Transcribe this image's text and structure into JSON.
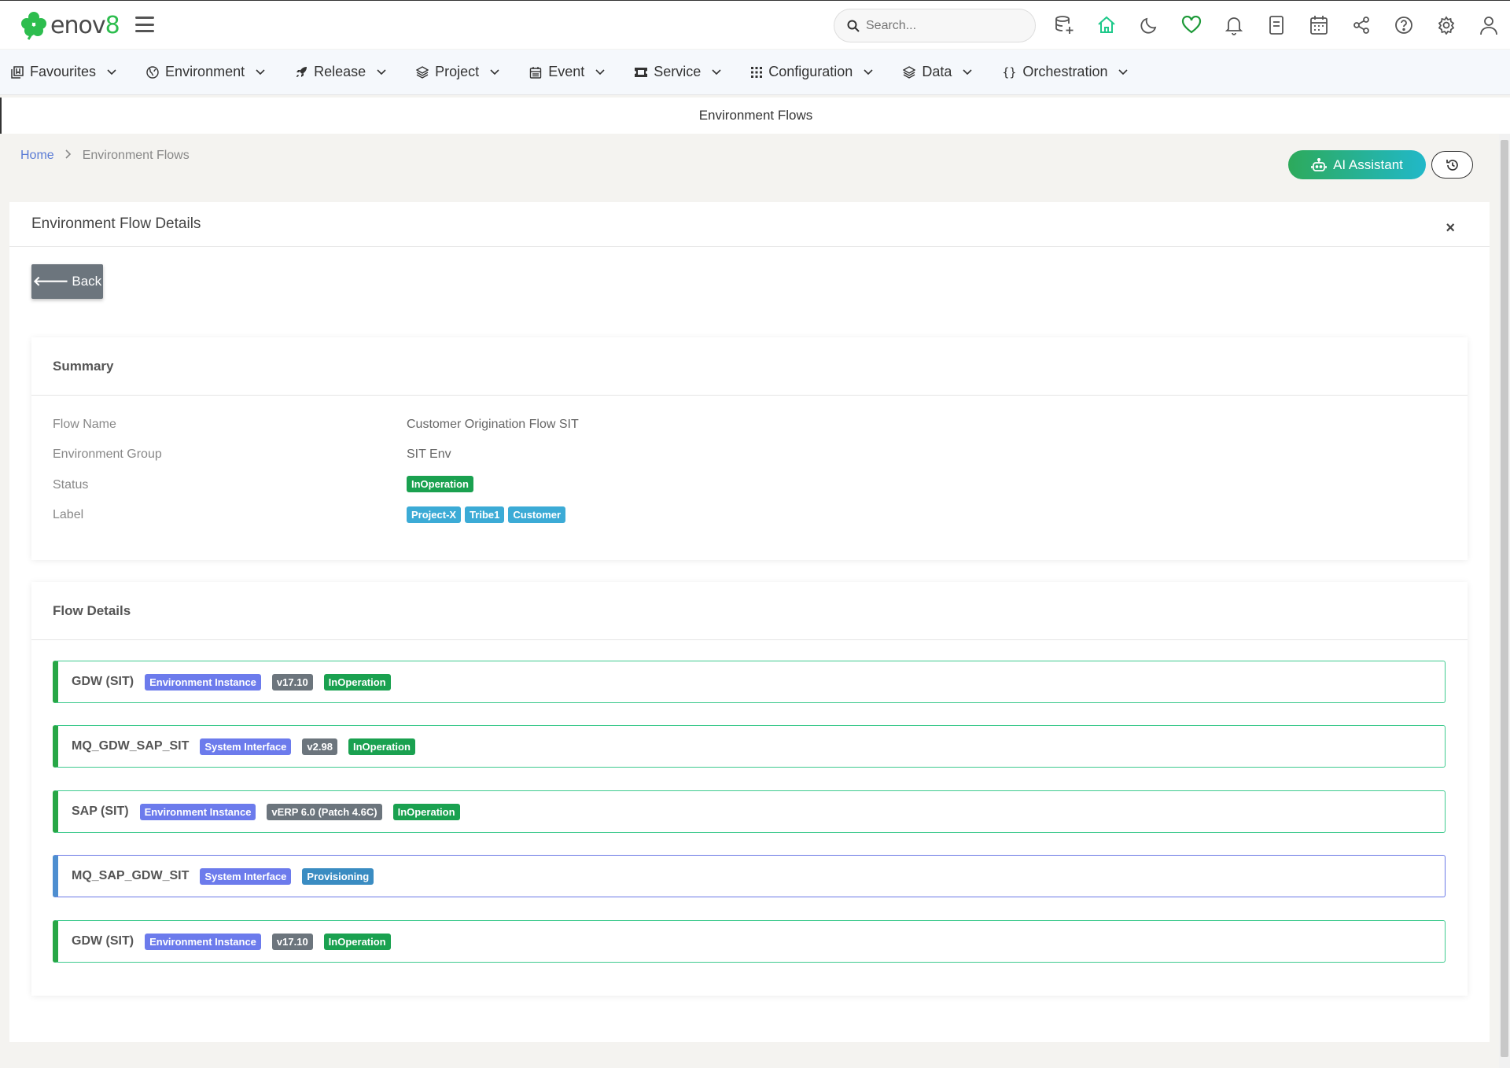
{
  "app": {
    "logo_text": "enov",
    "logo_eight": "8"
  },
  "search": {
    "placeholder": "Search..."
  },
  "top_icons": [
    "database-add-icon",
    "home-icon",
    "moon-icon",
    "heart-icon",
    "bell-icon",
    "document-icon",
    "calendar-icon",
    "share-icon",
    "help-icon",
    "gear-icon",
    "user-icon"
  ],
  "nav": {
    "items": [
      {
        "label": "Favourites",
        "icon": "favourites-icon"
      },
      {
        "label": "Environment",
        "icon": "globe-icon"
      },
      {
        "label": "Release",
        "icon": "rocket-icon"
      },
      {
        "label": "Project",
        "icon": "layers-icon"
      },
      {
        "label": "Event",
        "icon": "calendar-icon"
      },
      {
        "label": "Service",
        "icon": "ticket-icon"
      },
      {
        "label": "Configuration",
        "icon": "grid-icon"
      },
      {
        "label": "Data",
        "icon": "layers-icon"
      },
      {
        "label": "Orchestration",
        "icon": "braces-icon"
      }
    ]
  },
  "page_title": "Environment Flows",
  "breadcrumb": {
    "home": "Home",
    "current": "Environment Flows"
  },
  "actions": {
    "ai_assistant": "AI Assistant"
  },
  "card": {
    "title": "Environment Flow Details",
    "close": "×",
    "back": "Back"
  },
  "summary": {
    "title": "Summary",
    "rows": [
      {
        "label": "Flow Name",
        "value": "Customer Origination Flow SIT"
      },
      {
        "label": "Environment Group",
        "value": "SIT Env"
      },
      {
        "label": "Status",
        "value": "InOperation"
      },
      {
        "label": "Label",
        "values": [
          "Project-X",
          "Tribe1",
          "Customer"
        ]
      }
    ]
  },
  "flow_details": {
    "title": "Flow Details",
    "items": [
      {
        "name": "GDW (SIT)",
        "type": "Environment Instance",
        "version": "v17.10",
        "status": "InOperation"
      },
      {
        "name": "MQ_GDW_SAP_SIT",
        "type": "System Interface",
        "version": "v2.98",
        "status": "InOperation"
      },
      {
        "name": "SAP (SIT)",
        "type": "Environment Instance",
        "version": "vERP 6.0 (Patch 4.6C)",
        "status": "InOperation"
      },
      {
        "name": "MQ_SAP_GDW_SIT",
        "type": "System Interface",
        "version": null,
        "status": "Provisioning"
      },
      {
        "name": "GDW (SIT)",
        "type": "Environment Instance",
        "version": "v17.10",
        "status": "InOperation"
      }
    ]
  },
  "colors": {
    "brand_green": "#2dbd4e",
    "status_green": "#1aa150",
    "type_purple": "#6c7bec",
    "version_gray": "#6c757d",
    "label_cyan": "#3cabd6",
    "provisioning_blue": "#3a8cc2"
  }
}
